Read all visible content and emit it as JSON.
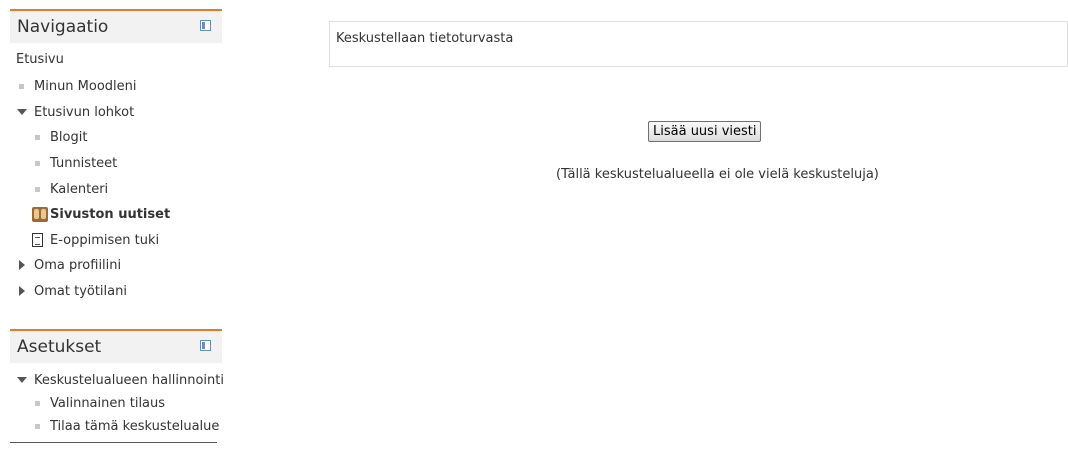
{
  "navigation": {
    "title": "Navigaatio",
    "items": [
      {
        "label": "Etusivu"
      },
      {
        "label": "Minun Moodleni"
      },
      {
        "label": "Etusivun lohkot"
      },
      {
        "label": "Blogit"
      },
      {
        "label": "Tunnisteet"
      },
      {
        "label": "Kalenteri"
      },
      {
        "label": "Sivuston uutiset"
      },
      {
        "label": "E-oppimisen tuki"
      },
      {
        "label": "Oma profiilini"
      },
      {
        "label": "Omat työtilani"
      }
    ]
  },
  "settings": {
    "title": "Asetukset",
    "items": [
      {
        "label": "Keskustelualueen hallinnointi"
      },
      {
        "label": "Valinnainen tilaus"
      },
      {
        "label": "Tilaa tämä keskustelualue"
      }
    ]
  },
  "main": {
    "intro": "Keskustellaan tietoturvasta",
    "add_button": "Lisää uusi viesti",
    "empty_note": "(Tällä keskustelualueella ei ole vielä keskusteluja)"
  },
  "colors": {
    "block_header_accent": "#e07b2c",
    "block_header_bg": "#f2f2f2"
  },
  "icons": {
    "dock": "dock-icon",
    "forum": "forum-icon",
    "page": "page-icon"
  }
}
